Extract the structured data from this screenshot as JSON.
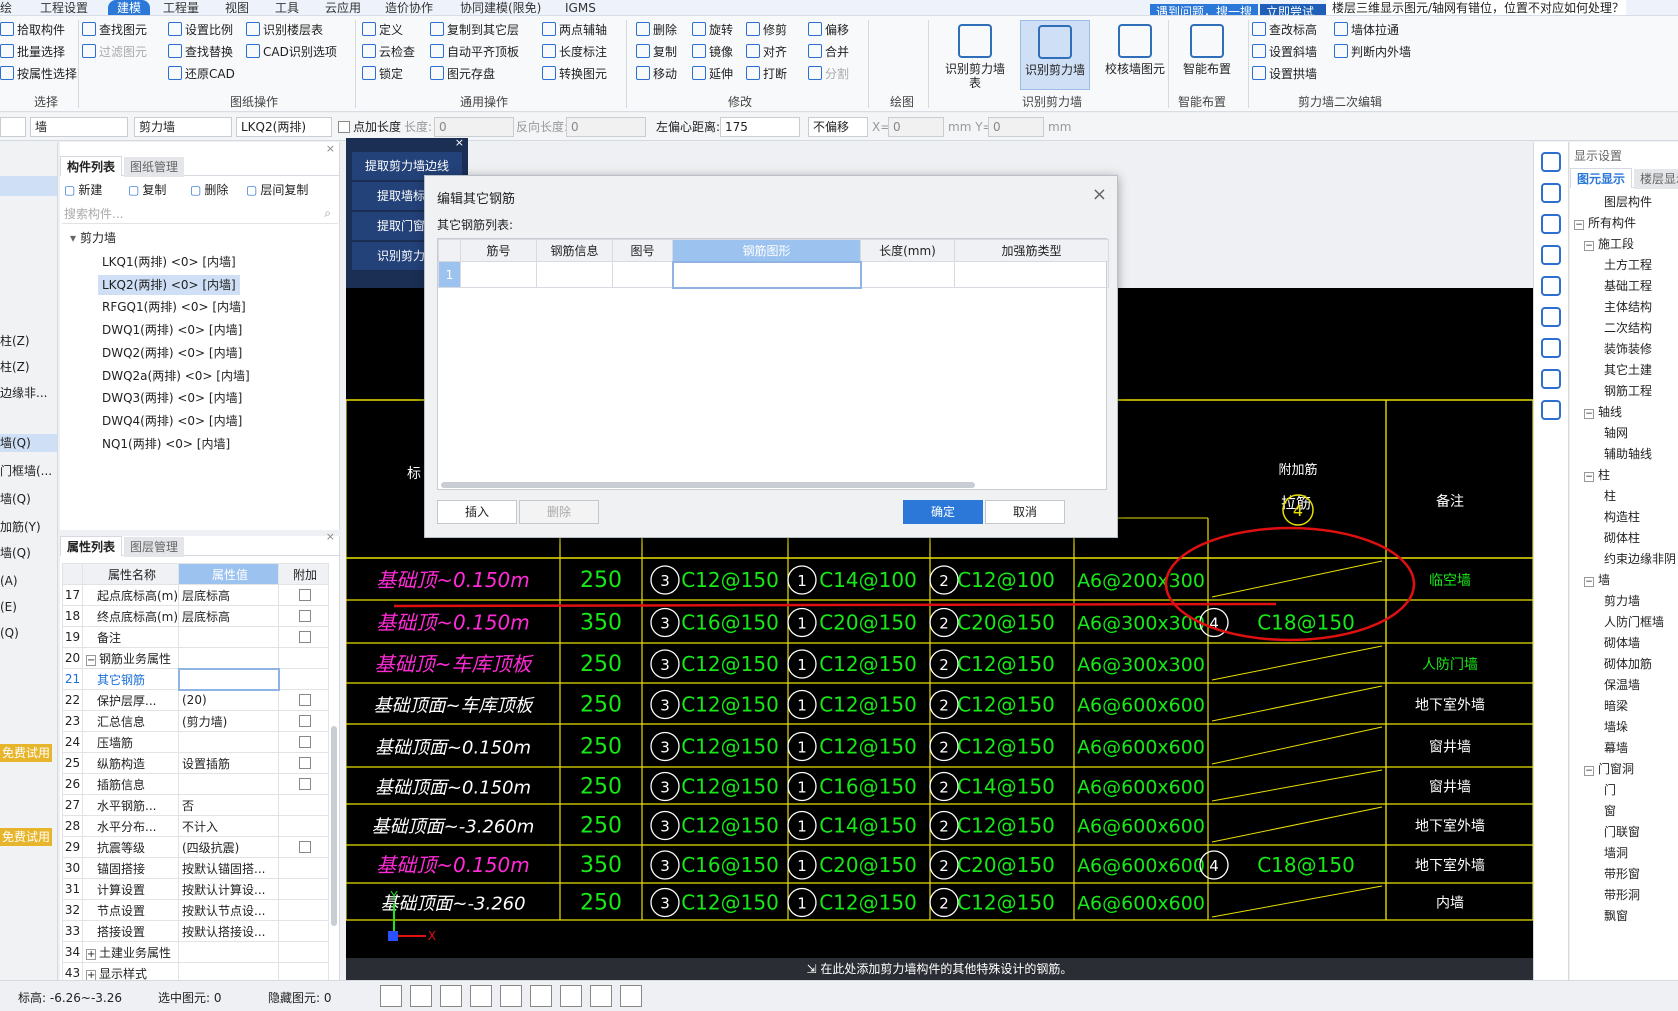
{
  "menu": [
    "绘",
    "工程设置",
    "建模",
    "工程量",
    "视图",
    "工具",
    "云应用",
    "造价协作",
    "协同建模(限免)",
    "IGMS"
  ],
  "help": {
    "search": "遇到问题，搜一搜",
    "try": "立即尝试",
    "question": "楼层三维显示图元/轴网有错位，位置不对应如何处理？"
  },
  "ribbon": {
    "pick": [
      "拾取构件",
      "批量选择",
      "按属性选择"
    ],
    "find": [
      "查找图元",
      "过滤图元"
    ],
    "draw_ops": [
      "设置比例",
      "查找替换",
      "还原CAD",
      "识别楼层表",
      "CAD识别选项"
    ],
    "general1": [
      "定义",
      "云检查",
      "锁定"
    ],
    "general2": [
      "复制到其它层",
      "自动平齐顶板",
      "图元存盘"
    ],
    "general3": [
      "两点辅轴",
      "长度标注",
      "转换图元"
    ],
    "modify1": [
      "删除",
      "复制",
      "移动"
    ],
    "modify2": [
      "旋转",
      "镜像",
      "延伸"
    ],
    "modify3": [
      "修剪",
      "对齐",
      "打断"
    ],
    "modify4": [
      "偏移",
      "合并",
      "分割"
    ],
    "big": [
      "识别剪力墙表",
      "识别剪力墙",
      "校核墙图元",
      "智能布置"
    ],
    "edit2": [
      "查改标高",
      "设置斜墙",
      "设置拱墙",
      "墙体拉通",
      "判断内外墙"
    ],
    "groups": [
      "选择",
      "图纸操作",
      "通用操作",
      "修改",
      "绘图",
      "识别剪力墙",
      "智能布置",
      "剪力墙二次编辑"
    ]
  },
  "toolbar2": {
    "sel1": "墙",
    "sel2": "剪力墙",
    "sel3": "LKQ2(两排)",
    "point_len": "点加长度",
    "len_label": "长度:",
    "len_val": "0",
    "rev_label": "反向长度:",
    "rev_val": "0",
    "ecc_label": "左偏心距离:",
    "ecc_val": "175",
    "offset": "不偏移",
    "x_label": "X=",
    "x_val": "0",
    "mm1": "mm Y=",
    "y_val": "0",
    "mm2": "mm"
  },
  "leftstrip": [
    "柱(Z)",
    "柱(Z)",
    "边缘非...",
    "墙(Q)",
    "门框墙(...",
    "墙(Q)",
    "加筋(Y)",
    "墙(Q)",
    "(A)",
    "(E)",
    "(Q)",
    "免费试用",
    "免费试用"
  ],
  "complist": {
    "tabs": [
      "构件列表",
      "图纸管理"
    ],
    "actions": [
      "新建",
      "复制",
      "删除",
      "层间复制"
    ],
    "search": "搜索构件...",
    "category": "剪力墙",
    "items": [
      "LKQ1(两排) <0> [内墙]",
      "LKQ2(两排) <0> [内墙]",
      "RFGQ1(两排) <0> [内墙]",
      "DWQ1(两排) <0> [内墙]",
      "DWQ2(两排) <0> [内墙]",
      "DWQ2a(两排) <0> [内墙]",
      "DWQ3(两排) <0> [内墙]",
      "DWQ4(两排) <0> [内墙]",
      "NQ1(两排) <0> [内墙]"
    ]
  },
  "props": {
    "tabs": [
      "属性列表",
      "图层管理"
    ],
    "headers": [
      "属性名称",
      "属性值",
      "附加"
    ],
    "rows": [
      [
        "17",
        "起点底标高(m)",
        "层底标高"
      ],
      [
        "18",
        "终点底标高(m)",
        "层底标高"
      ],
      [
        "19",
        "备注",
        ""
      ],
      [
        "20",
        "钢筋业务属性",
        ""
      ],
      [
        "21",
        "其它钢筋",
        ""
      ],
      [
        "22",
        "保护层厚...",
        "(20)"
      ],
      [
        "23",
        "汇总信息",
        "(剪力墙)"
      ],
      [
        "24",
        "压墙筋",
        ""
      ],
      [
        "25",
        "纵筋构造",
        "设置插筋"
      ],
      [
        "26",
        "插筋信息",
        ""
      ],
      [
        "27",
        "水平钢筋...",
        "否"
      ],
      [
        "28",
        "水平分布...",
        "不计入"
      ],
      [
        "29",
        "抗震等级",
        "(四级抗震)"
      ],
      [
        "30",
        "锚固搭接",
        "按默认锚固搭..."
      ],
      [
        "31",
        "计算设置",
        "按默认计算设..."
      ],
      [
        "32",
        "节点设置",
        "按默认节点设..."
      ],
      [
        "33",
        "搭接设置",
        "按默认搭接设..."
      ],
      [
        "34",
        "土建业务属性",
        ""
      ],
      [
        "43",
        "显示样式",
        ""
      ]
    ]
  },
  "flyout": [
    "提取剪力墙边线",
    "提取墙标识",
    "提取门窗线",
    "识别剪力墙"
  ],
  "cad": {
    "hdr": [
      "标",
      "高",
      "附加筋",
      "备注",
      "拉筋",
      "(竖向筋)",
      "(水平筋)"
    ],
    "rows": [
      {
        "h": "基础顶~0.150m",
        "t": "250",
        "v": "C12@150",
        "hz": "C14@100",
        "h2": "C12@100",
        "l": "A6@200x300",
        "x": "",
        "r": "临空墙"
      },
      {
        "h": "基础顶~0.150m",
        "t": "350",
        "v": "C16@150",
        "hz": "C20@150",
        "h2": "C20@150",
        "l": "A6@300x300",
        "x": "C18@150",
        "r": ""
      },
      {
        "h": "基础顶~车库顶板",
        "t": "250",
        "v": "C12@150",
        "hz": "C12@150",
        "h2": "C12@150",
        "l": "A6@300x300",
        "x": "",
        "r": "人防门墙"
      },
      {
        "h": "基础顶面~车库顶板",
        "t": "250",
        "v": "C12@150",
        "hz": "C12@150",
        "h2": "C12@150",
        "l": "A6@600x600",
        "x": "",
        "r": "地下室外墙"
      },
      {
        "h": "基础顶面~0.150m",
        "t": "250",
        "v": "C12@150",
        "hz": "C12@150",
        "h2": "C12@150",
        "l": "A6@600x600",
        "x": "",
        "r": "窗井墙"
      },
      {
        "h": "基础顶面~0.150m",
        "t": "250",
        "v": "C12@150",
        "hz": "C16@150",
        "h2": "C14@150",
        "l": "A6@600x600",
        "x": "",
        "r": "窗井墙"
      },
      {
        "h": "基础顶面~-3.260m",
        "t": "250",
        "v": "C12@150",
        "hz": "C14@150",
        "h2": "C12@150",
        "l": "A6@600x600",
        "x": "",
        "r": "地下室外墙"
      },
      {
        "h": "基础顶~0.150m",
        "t": "350",
        "v": "C16@150",
        "hz": "C20@150",
        "h2": "C20@150",
        "l": "A6@600x600",
        "x": "C18@150",
        "r": "地下室外墙"
      },
      {
        "h": "基础顶面~-3.260",
        "t": "250",
        "v": "C12@150",
        "hz": "C12@150",
        "h2": "C12@150",
        "l": "A6@600x600",
        "x": "",
        "r": "内墙"
      }
    ],
    "n1": "1",
    "n2": "2",
    "n3": "3",
    "n4": "4",
    "footer": "在此处添加剪力墙构件的其他特殊设计的钢筋。"
  },
  "right": {
    "title": "显示设置",
    "tabs": [
      "图元显示",
      "楼层显示"
    ],
    "items": [
      {
        "t": "图层构件",
        "lv": 2,
        "tg": ""
      },
      {
        "t": "所有构件",
        "lv": 0,
        "tg": "−"
      },
      {
        "t": "施工段",
        "lv": 1,
        "tg": "−"
      },
      {
        "t": "土方工程",
        "lv": 2
      },
      {
        "t": "基础工程",
        "lv": 2
      },
      {
        "t": "主体结构",
        "lv": 2
      },
      {
        "t": "二次结构",
        "lv": 2
      },
      {
        "t": "装饰装修",
        "lv": 2
      },
      {
        "t": "其它土建",
        "lv": 2
      },
      {
        "t": "钢筋工程",
        "lv": 2
      },
      {
        "t": "轴线",
        "lv": 1,
        "tg": "−"
      },
      {
        "t": "轴网",
        "lv": 2
      },
      {
        "t": "辅助轴线",
        "lv": 2
      },
      {
        "t": "柱",
        "lv": 1,
        "tg": "−"
      },
      {
        "t": "柱",
        "lv": 2
      },
      {
        "t": "构造柱",
        "lv": 2
      },
      {
        "t": "砌体柱",
        "lv": 2
      },
      {
        "t": "约束边缘非阴",
        "lv": 2
      },
      {
        "t": "墙",
        "lv": 1,
        "tg": "−"
      },
      {
        "t": "剪力墙",
        "lv": 2
      },
      {
        "t": "人防门框墙",
        "lv": 2
      },
      {
        "t": "砌体墙",
        "lv": 2
      },
      {
        "t": "砌体加筋",
        "lv": 2
      },
      {
        "t": "保温墙",
        "lv": 2
      },
      {
        "t": "暗梁",
        "lv": 2
      },
      {
        "t": "墙垛",
        "lv": 2
      },
      {
        "t": "幕墙",
        "lv": 2
      },
      {
        "t": "门窗洞",
        "lv": 1,
        "tg": "−"
      },
      {
        "t": "门",
        "lv": 2
      },
      {
        "t": "窗",
        "lv": 2
      },
      {
        "t": "门联窗",
        "lv": 2
      },
      {
        "t": "墙洞",
        "lv": 2
      },
      {
        "t": "带形窗",
        "lv": 2
      },
      {
        "t": "带形洞",
        "lv": 2
      },
      {
        "t": "飘窗",
        "lv": 2
      }
    ]
  },
  "status": {
    "elev": "标高:  -6.26~-3.26",
    "selected": "选中图元: 0",
    "hidden": "隐藏图元: 0"
  },
  "dialog": {
    "title": "编辑其它钢筋",
    "sub": "其它钢筋列表:",
    "cols": [
      "筋号",
      "钢筋信息",
      "图号",
      "钢筋图形",
      "长度(mm)",
      "加强筋类型"
    ],
    "rownum": "1",
    "buttons": [
      "插入",
      "删除",
      "确定",
      "取消"
    ]
  }
}
